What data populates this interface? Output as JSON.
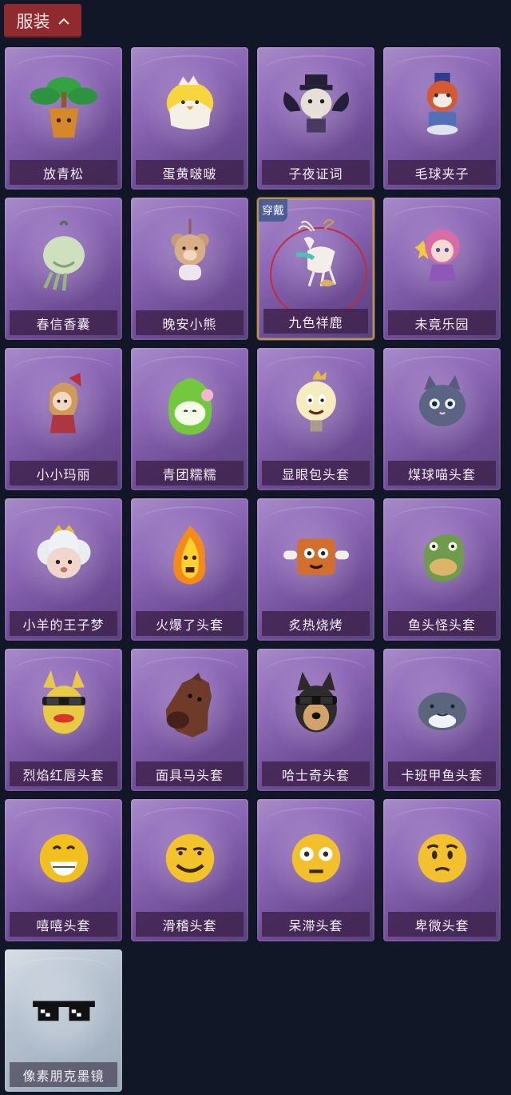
{
  "header": {
    "label": "服装"
  },
  "items": [
    {
      "label": "放青松",
      "icon": "pine-tree-plant-icon"
    },
    {
      "label": "蛋黄啵啵",
      "icon": "chick-egg-icon"
    },
    {
      "label": "子夜证词",
      "icon": "plague-doctor-icon"
    },
    {
      "label": "毛球夹子",
      "icon": "red-panda-drum-icon"
    },
    {
      "label": "春信香囊",
      "icon": "scent-pouch-icon"
    },
    {
      "label": "晚安小熊",
      "icon": "teddy-bear-icon"
    },
    {
      "label": "九色祥鹿",
      "icon": "deer-charm-icon",
      "badge": "穿戴"
    },
    {
      "label": "未竟乐园",
      "icon": "magical-girl-doll-icon"
    },
    {
      "label": "小小玛丽",
      "icon": "mary-doll-icon"
    },
    {
      "label": "青团糯糯",
      "icon": "green-mochi-icon"
    },
    {
      "label": "显眼包头套",
      "icon": "lightbulb-head-icon"
    },
    {
      "label": "煤球喵头套",
      "icon": "black-cat-head-icon"
    },
    {
      "label": "小羊的王子梦",
      "icon": "sheep-prince-icon"
    },
    {
      "label": "火爆了头套",
      "icon": "fire-spirit-icon"
    },
    {
      "label": "炙热烧烤",
      "icon": "bbq-meat-icon"
    },
    {
      "label": "鱼头怪头套",
      "icon": "fish-head-icon"
    },
    {
      "label": "烈焰红唇头套",
      "icon": "yellow-pokemon-mask-icon"
    },
    {
      "label": "面具马头套",
      "icon": "horse-mask-icon"
    },
    {
      "label": "哈士奇头套",
      "icon": "husky-head-icon"
    },
    {
      "label": "卡班甲鱼头套",
      "icon": "fish-shark-head-icon"
    },
    {
      "label": "嘻嘻头套",
      "icon": "grinning-emoji-icon"
    },
    {
      "label": "滑稽头套",
      "icon": "smirk-emoji-icon"
    },
    {
      "label": "呆滞头套",
      "icon": "dazed-emoji-icon"
    },
    {
      "label": "卑微头套",
      "icon": "timid-emoji-icon"
    },
    {
      "label": "像素朋克墨镜",
      "icon": "pixel-sunglasses-icon"
    }
  ],
  "colors": {
    "background": "#111726",
    "header": "#8f2b2e",
    "badge": "#4d5d96",
    "selected_border": "#b79555"
  }
}
